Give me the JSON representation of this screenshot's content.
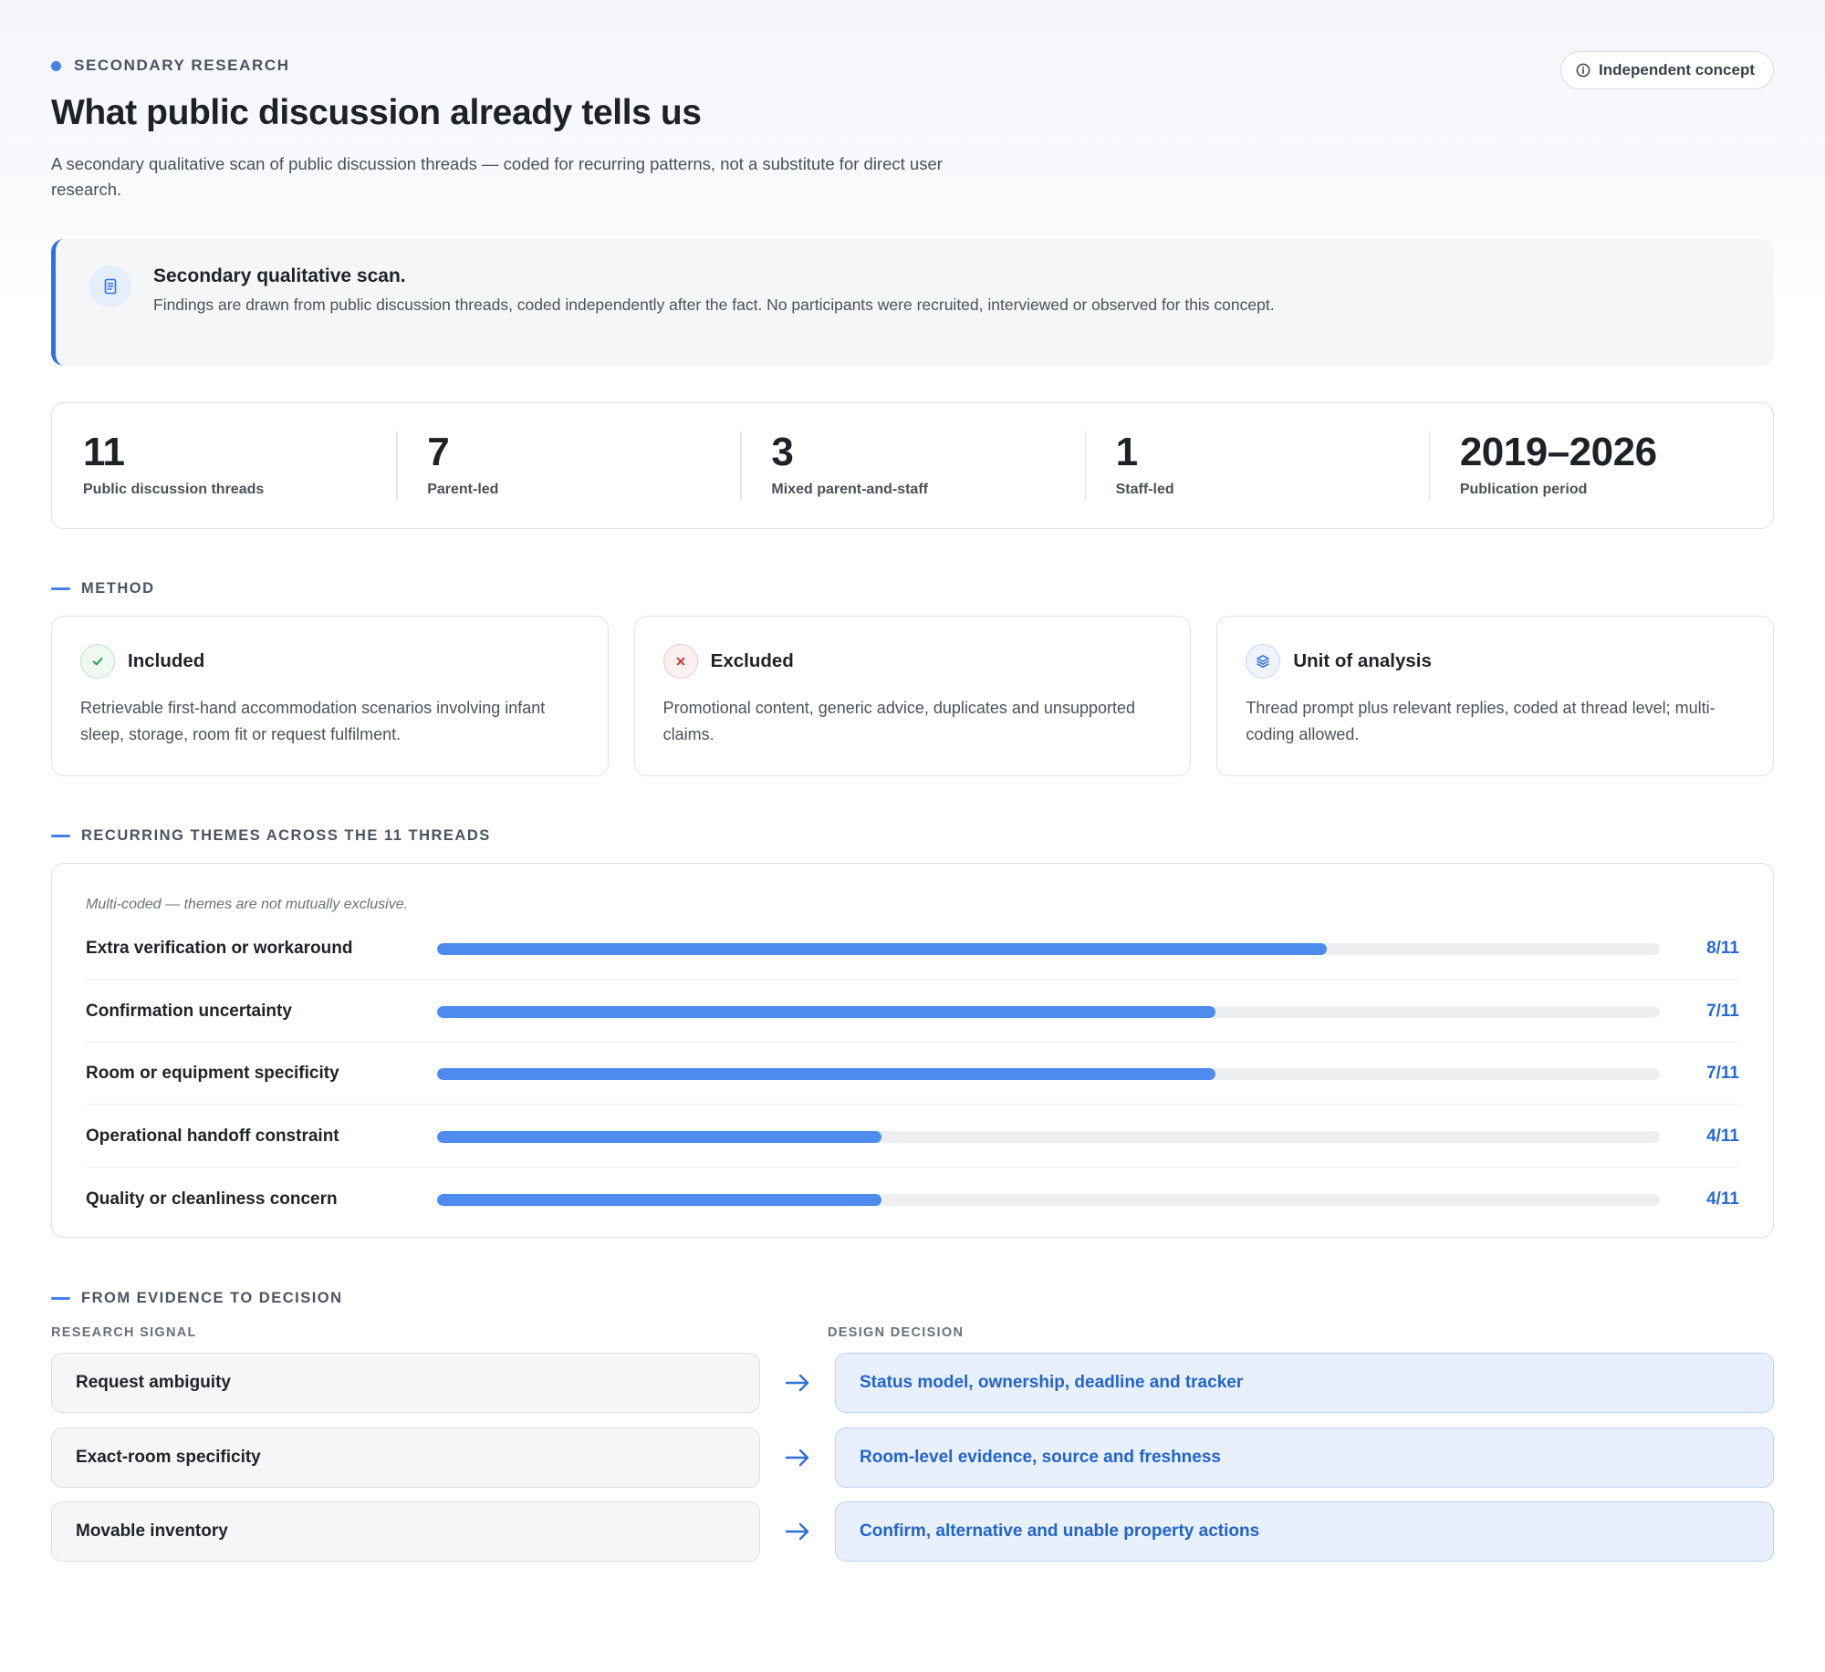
{
  "header": {
    "eyebrow": "SECONDARY RESEARCH",
    "badge": "Independent concept",
    "title": "What public discussion already tells us",
    "subtitle": "A secondary qualitative scan of public discussion threads — coded for recurring patterns, not a substitute for direct user research."
  },
  "callout": {
    "icon": "document-icon",
    "title": "Secondary qualitative scan.",
    "body": "Findings are drawn from public discussion threads, coded independently after the fact. No participants were recruited, interviewed or observed for this concept."
  },
  "stats": [
    {
      "value": "11",
      "label": "Public discussion threads"
    },
    {
      "value": "7",
      "label": "Parent-led"
    },
    {
      "value": "3",
      "label": "Mixed parent-and-staff"
    },
    {
      "value": "1",
      "label": "Staff-led"
    },
    {
      "value": "2019–2026",
      "label": "Publication period"
    }
  ],
  "method": {
    "label": "METHOD",
    "cards": [
      {
        "icon": "check-icon",
        "title": "Included",
        "text": "Retrievable first-hand accommodation scenarios involving infant sleep, storage, room fit or request fulfilment."
      },
      {
        "icon": "cross-icon",
        "title": "Excluded",
        "text": "Promotional content, generic advice, duplicates and unsupported claims."
      },
      {
        "icon": "layers-icon",
        "title": "Unit of analysis",
        "text": "Thread prompt plus relevant replies, coded at thread level; multi-coding allowed."
      }
    ]
  },
  "themes": {
    "label": "RECURRING THEMES ACROSS THE 11 THREADS",
    "note": "Multi-coded — themes are not mutually exclusive.",
    "total": 11,
    "items": [
      {
        "label": "Extra verification or workaround",
        "count": 8,
        "display": "8/11"
      },
      {
        "label": "Confirmation uncertainty",
        "count": 7,
        "display": "7/11"
      },
      {
        "label": "Room or equipment specificity",
        "count": 7,
        "display": "7/11"
      },
      {
        "label": "Operational handoff constraint",
        "count": 4,
        "display": "4/11"
      },
      {
        "label": "Quality or cleanliness concern",
        "count": 4,
        "display": "4/11"
      }
    ]
  },
  "evidence": {
    "label": "FROM EVIDENCE TO DECISION",
    "signal_header": "RESEARCH SIGNAL",
    "decision_header": "DESIGN DECISION",
    "pairs": [
      {
        "signal": "Request ambiguity",
        "decision": "Status model, ownership, deadline and tracker"
      },
      {
        "signal": "Exact-room specificity",
        "decision": "Room-level evidence, source and freshness"
      },
      {
        "signal": "Movable inventory",
        "decision": "Confirm, alternative and unable property actions"
      }
    ]
  },
  "colors": {
    "accent": "#3f83e8",
    "bar_fill": "#4d8bef",
    "value_text": "#2769d4"
  }
}
